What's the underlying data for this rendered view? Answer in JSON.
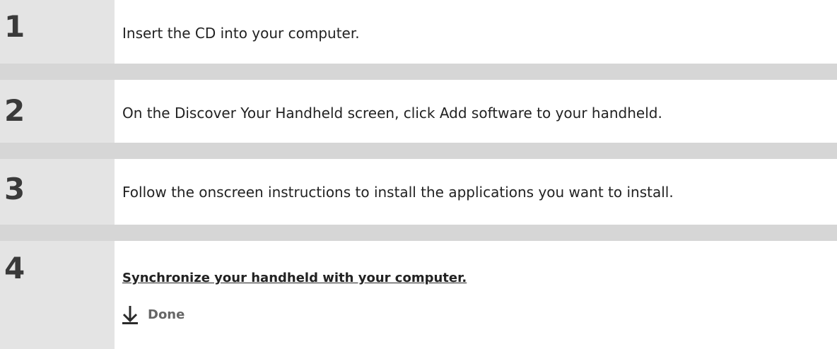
{
  "steps": [
    {
      "number": "1",
      "text": "Insert the CD into your computer."
    },
    {
      "number": "2",
      "text": "On the Discover Your Handheld screen, click Add software to your handheld."
    },
    {
      "number": "3",
      "text": "Follow the onscreen instructions to install the applications you want to install."
    },
    {
      "number": "4",
      "link": "Synchronize your handheld with your computer.",
      "done_label": "Done",
      "done_icon": "arrow-down-icon"
    }
  ],
  "colors": {
    "number_column_bg": "#e4e4e4",
    "separator_bg": "#d6d6d6",
    "text": "#222222",
    "done_text": "#666666"
  }
}
